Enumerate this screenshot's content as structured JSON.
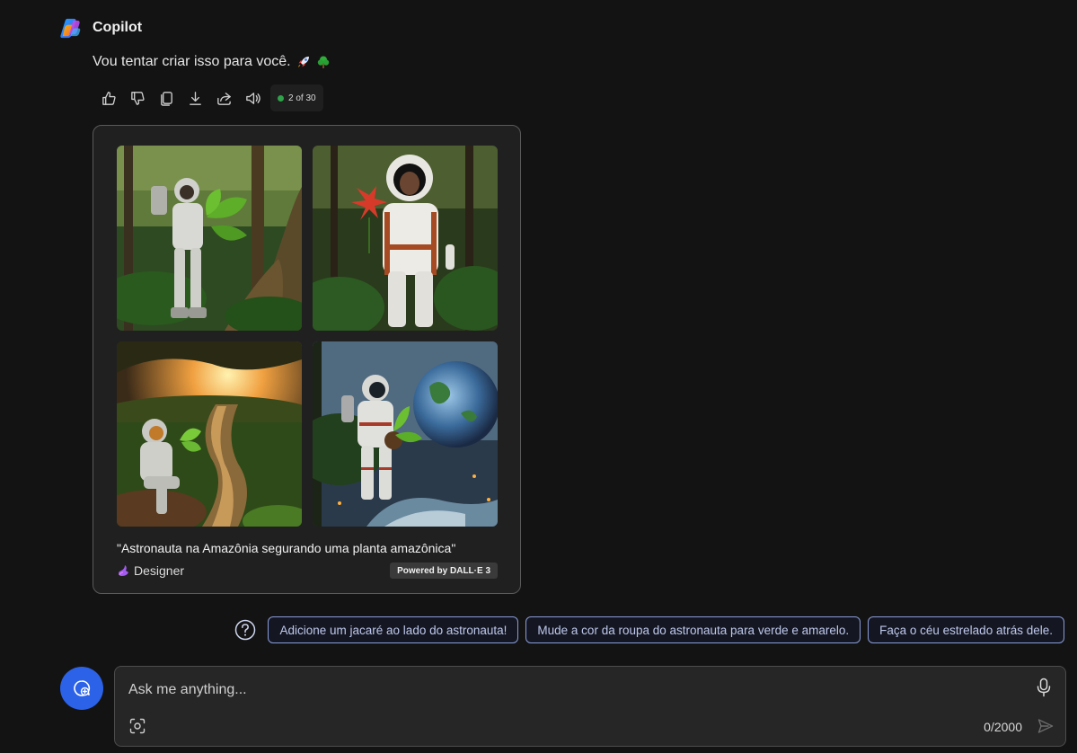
{
  "app": {
    "name": "Copilot"
  },
  "message": {
    "text": "Vou tentar criar isso para você."
  },
  "actions": {
    "icons": [
      "thumbs-up-icon",
      "thumbs-down-icon",
      "copy-icon",
      "download-icon",
      "share-icon",
      "speaker-icon"
    ],
    "counter": "2 of 30"
  },
  "result": {
    "caption": "\"Astronauta na Amazônia segurando uma planta amazônica\"",
    "designer_label": "Designer",
    "powered_by": "Powered by DALL·E 3"
  },
  "suggestions": [
    "Adicione um jacaré ao lado do astronauta!",
    "Mude a cor da roupa do astronauta para verde e amarelo.",
    "Faça o céu estrelado atrás dele."
  ],
  "composer": {
    "placeholder": "Ask me anything...",
    "char_count": "0/2000"
  },
  "colors": {
    "background": "#131313",
    "accent_blue": "#2c62e8",
    "chip_border": "#8a9bd8",
    "status_green": "#2fa24a"
  }
}
